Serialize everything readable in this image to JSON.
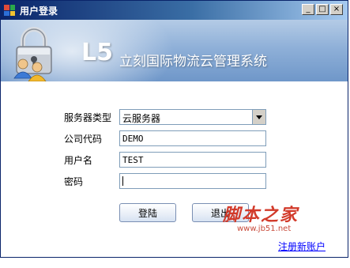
{
  "window": {
    "title": "用户登录",
    "controls": {
      "minimize": "_",
      "maximize": "□",
      "close": "×"
    }
  },
  "banner": {
    "brand": "L5",
    "subtitle": "立刻国际物流云管理系统",
    "icon": "lock-users-icon"
  },
  "form": {
    "server_type_label": "服务器类型",
    "server_type_value": "云服务器",
    "company_code_label": "公司代码",
    "company_code_value": "DEMO",
    "username_label": "用户名",
    "username_value": "TEST",
    "password_label": "密码",
    "password_value": ""
  },
  "buttons": {
    "login": "登陆",
    "exit": "退出"
  },
  "links": {
    "register": "注册新账户"
  },
  "watermark": {
    "main": "脚本之家",
    "url": "www.jb51.net"
  },
  "colors": {
    "titlebar": "#0a246a",
    "banner": "#8fb0d8",
    "link": "#0000ff",
    "watermark": "#d23a2a"
  }
}
